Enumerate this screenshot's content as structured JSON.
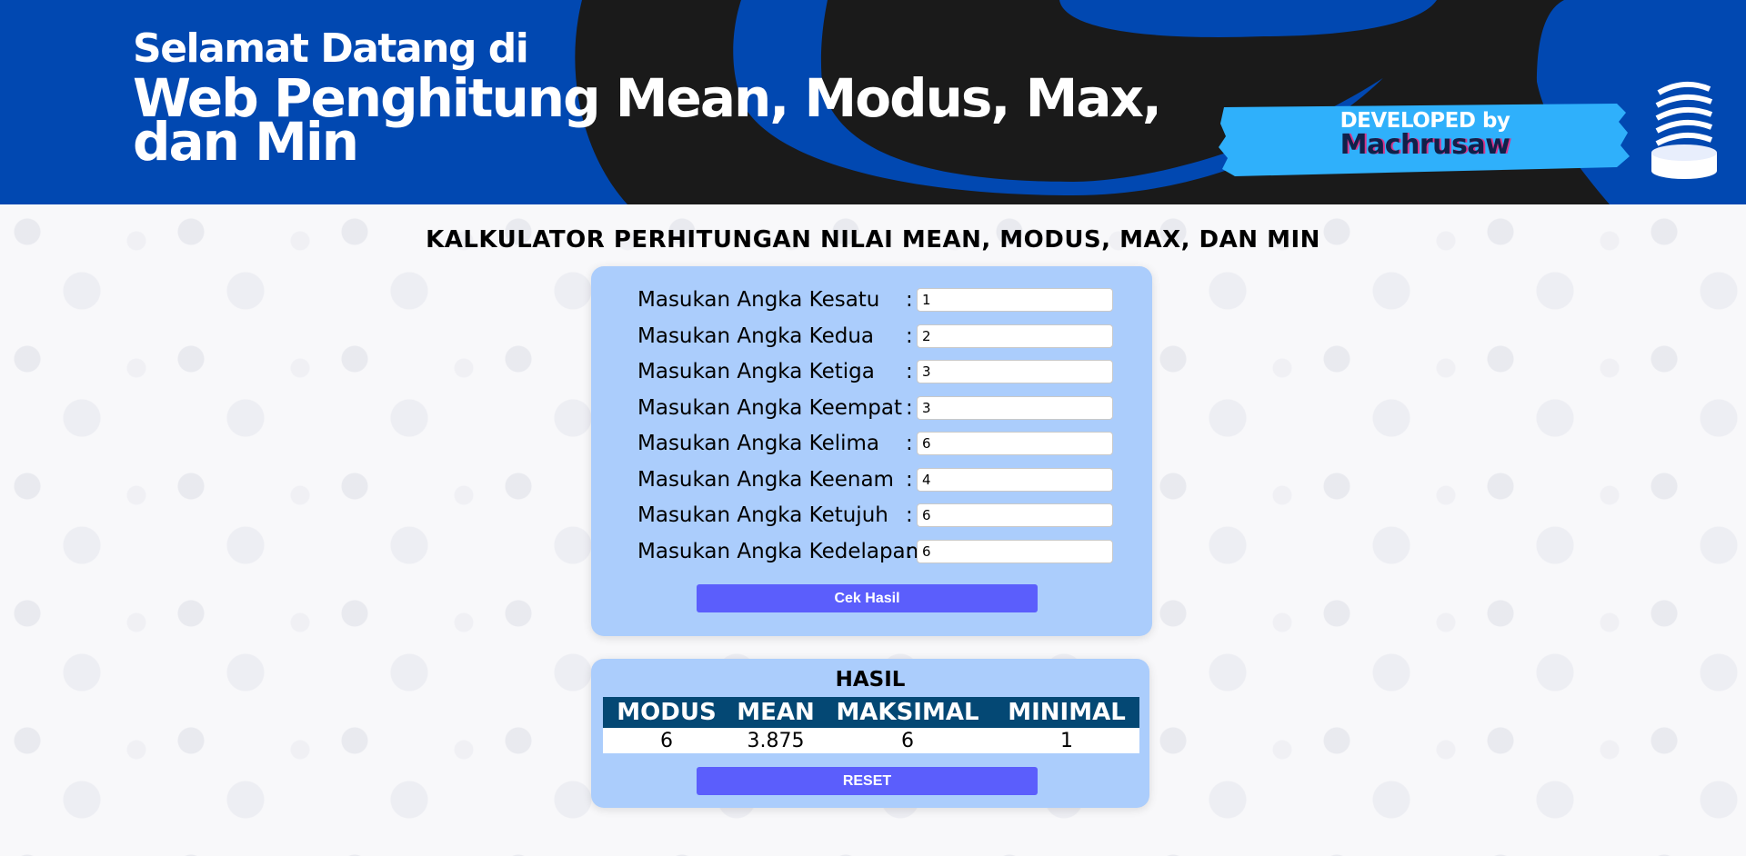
{
  "banner": {
    "welcome": "Selamat Datang di",
    "headline": "Web Penghitung Mean, Modus, Max, dan Min",
    "dev_line1": "DEVELOPED by",
    "dev_line2": "Machrusaw"
  },
  "page_title": "KALKULATOR PERHITUNGAN NILAI MEAN, MODUS, MAX, DAN MIN",
  "form": {
    "rows": [
      {
        "label": "Masukan Angka Kesatu",
        "value": "1"
      },
      {
        "label": "Masukan Angka Kedua",
        "value": "2"
      },
      {
        "label": "Masukan Angka Ketiga",
        "value": "3"
      },
      {
        "label": "Masukan Angka Keempat",
        "value": "3"
      },
      {
        "label": "Masukan Angka Kelima",
        "value": "6"
      },
      {
        "label": "Masukan Angka Keenam",
        "value": "4"
      },
      {
        "label": "Masukan Angka Ketujuh",
        "value": "6"
      },
      {
        "label": "Masukan Angka Kedelapan",
        "value": "6"
      }
    ],
    "colon": ":",
    "submit_label": "Cek Hasil"
  },
  "result": {
    "title": "HASIL",
    "headers": [
      "MODUS",
      "MEAN",
      "MAKSIMAL",
      "MINIMAL"
    ],
    "values": [
      "6",
      "3.875",
      "6",
      "1"
    ],
    "reset_label": "RESET"
  },
  "colors": {
    "banner_bg": "#0148b1",
    "card_bg": "#abcdfc",
    "button_bg": "#5b5efc",
    "table_header_bg": "#044874",
    "badge_bg": "#2fb0fb"
  }
}
